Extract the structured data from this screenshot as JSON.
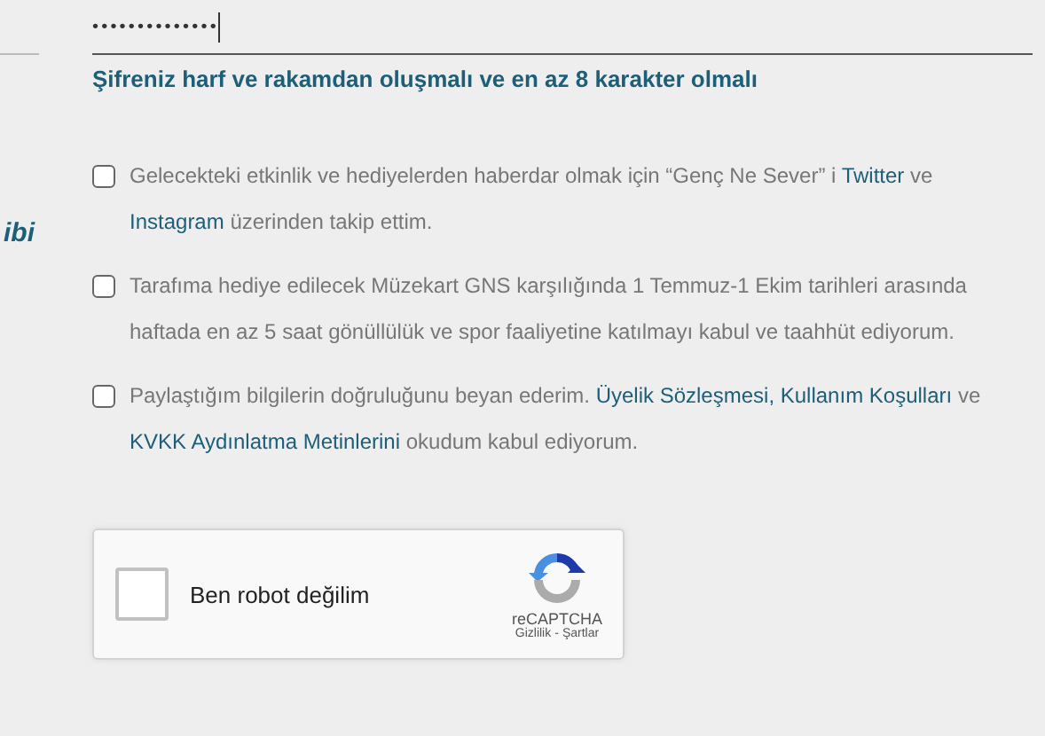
{
  "side": {
    "label": "ibi"
  },
  "password": {
    "value": "••••••••••••••"
  },
  "hint": "Şifreniz harf ve rakamdan oluşmalı ve en az 8 karakter olmalı",
  "consents": [
    {
      "checked": false,
      "parts": [
        {
          "kind": "text",
          "text": "Gelecekteki etkinlik ve hediyelerden haberdar olmak için “Genç Ne Sever” i"
        },
        {
          "kind": "link",
          "text": "Twitter"
        },
        {
          "kind": "text",
          "text": "ve"
        },
        {
          "kind": "link",
          "text": "Instagram"
        },
        {
          "kind": "text",
          "text": "üzerinden takip ettim."
        }
      ]
    },
    {
      "checked": false,
      "parts": [
        {
          "kind": "text",
          "text": "Tarafıma hediye edilecek Müzekart GNS karşılığında 1 Temmuz-1 Ekim tarihleri arasında haftada en az 5 saat gönüllülük ve spor faaliyetine katılmayı kabul ve taahhüt ediyorum."
        }
      ]
    },
    {
      "checked": false,
      "parts": [
        {
          "kind": "text",
          "text": "Paylaştığım bilgilerin doğruluğunu beyan ederim."
        },
        {
          "kind": "link",
          "text": "Üyelik Sözleşmesi,"
        },
        {
          "kind": "link",
          "text": "Kullanım Koşulları"
        },
        {
          "kind": "text",
          "text": "ve"
        },
        {
          "kind": "link",
          "text": "KVKK Aydınlatma Metinlerini"
        },
        {
          "kind": "text",
          "text": "okudum kabul ediyorum."
        }
      ]
    }
  ],
  "captcha": {
    "checked": false,
    "label": "Ben robot değilim",
    "brand": "reCAPTCHA",
    "links": [
      "Gizlilik",
      "Şartlar"
    ],
    "separator": "-"
  }
}
